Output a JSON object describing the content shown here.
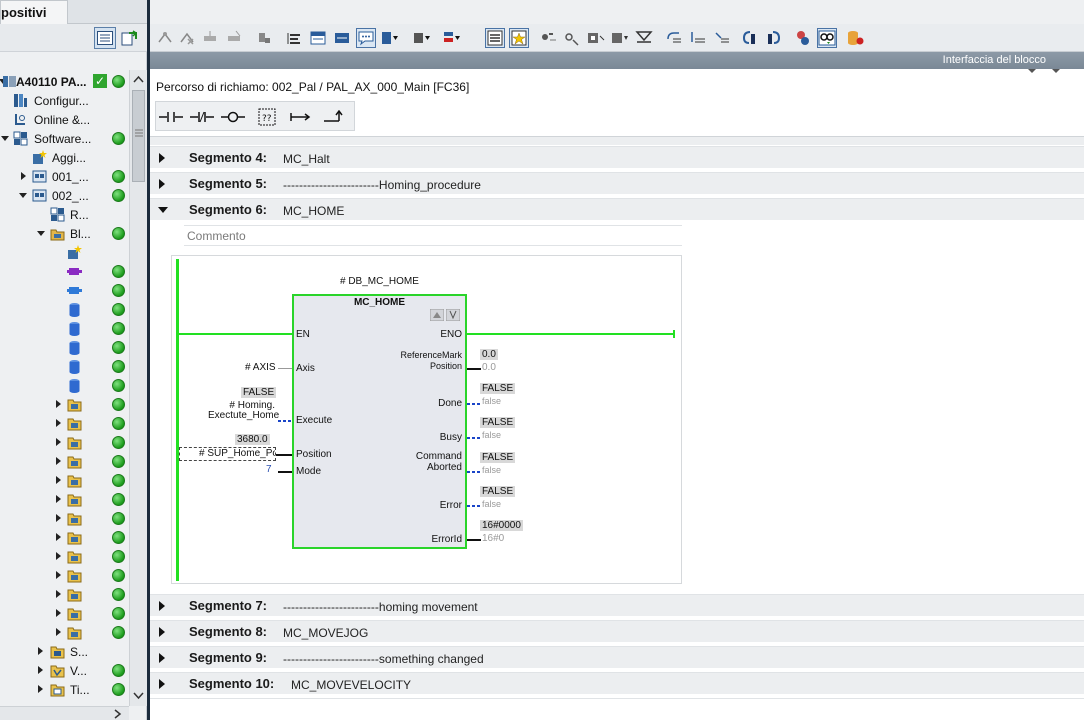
{
  "left_panel": {
    "tab_title": "positivi",
    "tree": [
      {
        "label": "A40110 PA...",
        "bold": true,
        "check": true,
        "dot": true
      },
      {
        "label": "Configur...",
        "dot": false
      },
      {
        "label": "Online &...",
        "dot": false
      },
      {
        "label": "Software...",
        "dot": true
      },
      {
        "label": "Aggi...",
        "dot": false
      },
      {
        "label": "001_...",
        "dot": true
      },
      {
        "label": "002_...",
        "dot": true
      },
      {
        "label": "R...",
        "dot": false
      },
      {
        "label": "Bl...",
        "dot": true
      },
      {
        "label": "S...",
        "dot": false
      },
      {
        "label": "V...",
        "dot": true
      },
      {
        "label": "Ti...",
        "dot": true
      }
    ]
  },
  "toolbar": {
    "interface_label": "Interfaccia del blocco"
  },
  "editor": {
    "call_path": "Percorso di richiamo: 002_Pal / PAL_AX_000_Main [FC36]",
    "ladder_buttons": [
      "┤├",
      "┤/├",
      "─○─",
      "??",
      "↦",
      "↲"
    ],
    "segments_above": [
      {
        "name": "Segmento 4:",
        "title": "MC_Halt"
      },
      {
        "name": "Segmento 5:",
        "title": "------------------------Homing_procedure"
      }
    ],
    "open_segment": {
      "name": "Segmento 6:",
      "title": "MC_HOME",
      "comment_placeholder": "Commento"
    },
    "segments_below": [
      {
        "name": "Segmento 7:",
        "title": "------------------------homing movement"
      },
      {
        "name": "Segmento 8:",
        "title": "MC_MOVEJOG"
      },
      {
        "name": "Segmento 9:",
        "title": "------------------------something changed"
      },
      {
        "name": "Segmento 10:",
        "title": "MC_MOVEVELOCITY"
      }
    ]
  },
  "fb": {
    "instance": "# DB_MC_HOME",
    "type": "MC_HOME",
    "in_en": "EN",
    "in_axis": "Axis",
    "in_execute": "Execute",
    "in_position": "Position",
    "in_mode": "Mode",
    "out_eno": "ENO",
    "out_refmark_1": "ReferenceMark",
    "out_refmark_2": "Position",
    "out_done": "Done",
    "out_busy": "Busy",
    "out_cmdab_1": "Command",
    "out_cmdab_2": "Aborted",
    "out_error": "Error",
    "out_errorid": "ErrorId",
    "arg_axis": "# AXIS",
    "arg_execute_val": "FALSE",
    "arg_execute_1": "# Homing.",
    "arg_execute_2": "Exectute_Home",
    "arg_position_val": "3680.0",
    "arg_position": "# SUP_Home_Pos",
    "arg_mode": "7",
    "val_refmark": "0.0",
    "val_refmark_gray": "0.0",
    "val_done": "FALSE",
    "val_done_gray": "false",
    "val_busy": "FALSE",
    "val_busy_gray": "false",
    "val_cmdab": "FALSE",
    "val_cmdab_gray": "false",
    "val_error": "FALSE",
    "val_error_gray": "false",
    "val_errorid": "16#0000",
    "val_errorid_gray": "16#0"
  }
}
